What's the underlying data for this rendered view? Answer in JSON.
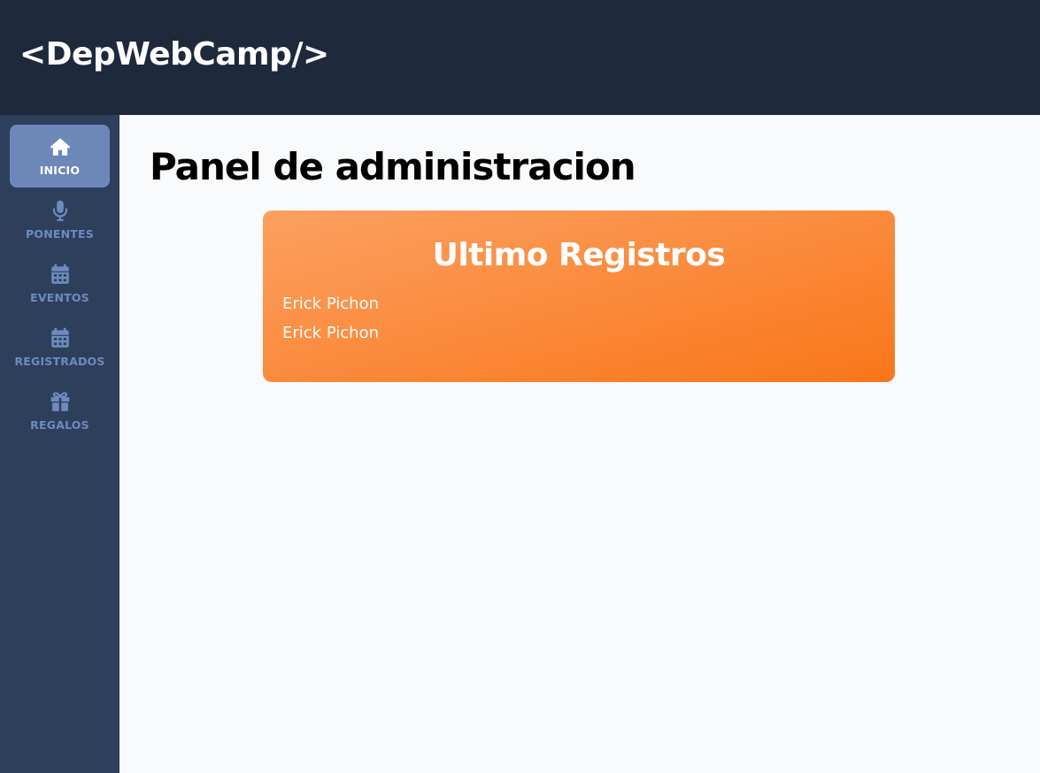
{
  "header": {
    "logo": "<DepWebCamp/>"
  },
  "sidebar": {
    "items": [
      {
        "label": "INICIO",
        "icon": "home-icon",
        "active": true
      },
      {
        "label": "PONENTES",
        "icon": "microphone-icon",
        "active": false
      },
      {
        "label": "EVENTOS",
        "icon": "calendar-icon",
        "active": false
      },
      {
        "label": "REGISTRADOS",
        "icon": "calendar-icon",
        "active": false
      },
      {
        "label": "REGALOS",
        "icon": "gift-icon",
        "active": false
      }
    ]
  },
  "main": {
    "title": "Panel de administracion",
    "card": {
      "title": "Ultimo Registros",
      "registros": [
        "Erick Pichon",
        "Erick Pichon"
      ]
    }
  },
  "colors": {
    "header_bg": "#1e293b",
    "sidebar_bg": "#2e3f5c",
    "active_item_bg": "#6d87b8",
    "inactive_item_text": "#6e8bbf",
    "card_gradient_start": "#fca061",
    "card_gradient_end": "#f97619"
  }
}
